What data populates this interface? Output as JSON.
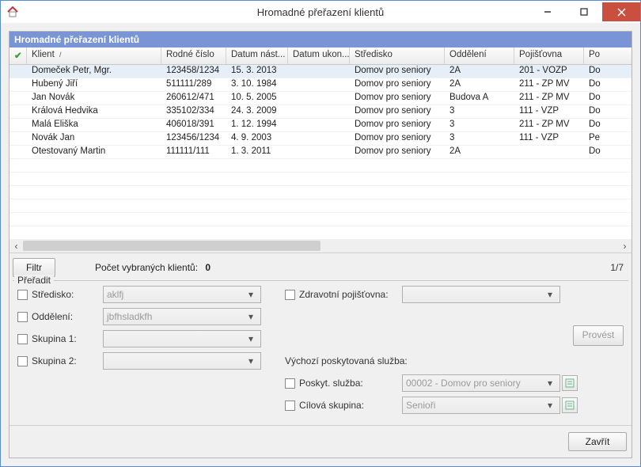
{
  "window": {
    "title": "Hromadné přeřazení klientů"
  },
  "panel": {
    "title": "Hromadné přeřazení klientů"
  },
  "columns": {
    "check": "",
    "klient": "Klient",
    "rodne": "Rodné číslo",
    "nast": "Datum nást...",
    "ukon": "Datum ukon...",
    "stredisko": "Středisko",
    "oddeleni": "Oddělení",
    "pojistovna": "Pojišťovna",
    "po": "Po"
  },
  "sort_indicator": "/",
  "rows": [
    {
      "klient": "Domeček Petr, Mgr.",
      "rodne": "123458/1234",
      "nast": "15. 3. 2013",
      "ukon": "",
      "stredisko": "Domov pro seniory",
      "oddeleni": "2A",
      "pojistovna": "201 - VOZP",
      "po": "Do"
    },
    {
      "klient": "Hubený Jiří",
      "rodne": "511111/289",
      "nast": "3. 10. 1984",
      "ukon": "",
      "stredisko": "Domov pro seniory",
      "oddeleni": "2A",
      "pojistovna": "211 - ZP MV",
      "po": "Do"
    },
    {
      "klient": "Jan Novák",
      "rodne": "260612/471",
      "nast": "10. 5. 2005",
      "ukon": "",
      "stredisko": "Domov pro seniory",
      "oddeleni": "Budova A",
      "pojistovna": "211 - ZP MV",
      "po": "Do"
    },
    {
      "klient": "Králová Hedvika",
      "rodne": "335102/334",
      "nast": "24. 3. 2009",
      "ukon": "",
      "stredisko": "Domov pro seniory",
      "oddeleni": "3",
      "pojistovna": "111 - VZP",
      "po": "Do"
    },
    {
      "klient": "Malá Eliška",
      "rodne": "406018/391",
      "nast": "1. 12. 1994",
      "ukon": "",
      "stredisko": "Domov pro seniory",
      "oddeleni": "3",
      "pojistovna": "211 - ZP MV",
      "po": "Do"
    },
    {
      "klient": "Novák Jan",
      "rodne": "123456/1234",
      "nast": "4. 9. 2003",
      "ukon": "",
      "stredisko": "Domov pro seniory",
      "oddeleni": "3",
      "pojistovna": "111 - VZP",
      "po": "Pe"
    },
    {
      "klient": "Otestovaný Martin",
      "rodne": "111111/111",
      "nast": "1. 3. 2011",
      "ukon": "",
      "stredisko": "Domov pro seniory",
      "oddeleni": "2A",
      "pojistovna": "",
      "po": "Do"
    }
  ],
  "toolbar": {
    "filtr": "Filtr",
    "count_label": "Počet vybraných klientů:",
    "count_value": "0",
    "pager": "1/7"
  },
  "fieldset": {
    "legend": "Přeřadit",
    "stredisko_label": "Středisko:",
    "stredisko_value": "aklfj",
    "oddeleni_label": "Oddělení:",
    "oddeleni_value": "jbfhsladkfh",
    "skupina1_label": "Skupina 1:",
    "skupina1_value": "",
    "skupina2_label": "Skupina 2:",
    "skupina2_value": "",
    "zdrav_label": "Zdravotní pojišťovna:",
    "zdrav_value": "",
    "vychozi_label": "Výchozí poskytovaná služba:",
    "poskyt_label": "Poskyt. služba:",
    "poskyt_value": "00002 - Domov pro seniory",
    "cilova_label": "Cílová skupina:",
    "cilova_value": "Senioři",
    "provest": "Provést"
  },
  "footer": {
    "zavrit": "Zavřít"
  }
}
